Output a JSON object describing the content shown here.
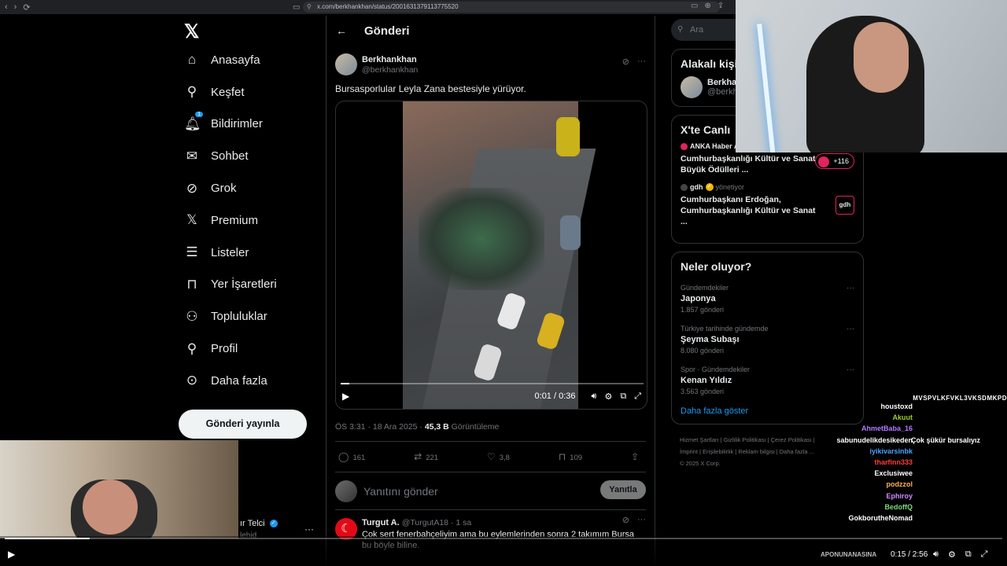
{
  "browser": {
    "url": "x.com/berkhankhan/status/2001631379113775520"
  },
  "sidebar": {
    "items": [
      {
        "label": "Anasayfa"
      },
      {
        "label": "Keşfet"
      },
      {
        "label": "Bildirimler",
        "badge": "1"
      },
      {
        "label": "Sohbet"
      },
      {
        "label": "Grok"
      },
      {
        "label": "Premium"
      },
      {
        "label": "Listeler"
      },
      {
        "label": "Yer İşaretleri"
      },
      {
        "label": "Topluluklar"
      },
      {
        "label": "Profil"
      },
      {
        "label": "Daha fazla"
      }
    ],
    "post_button": "Gönderi yayınla",
    "user_name": "ır Telci",
    "user_handle": "lehid"
  },
  "main": {
    "header_title": "Gönderi",
    "author_name": "Berkhankhan",
    "author_handle": "@berkhankhan",
    "text": "Bursasporlular Leyla Zana bestesiyle yürüyor.",
    "video": {
      "time": "0:01 / 0:36",
      "progress": 0.028
    },
    "meta_time": "ÖS 3:31 · 18 Ara 2025 · ",
    "meta_views": "45,3 B",
    "meta_views_label": " Görüntüleme",
    "actions": {
      "replies": "161",
      "reposts": "221",
      "likes": "3,8",
      "bookmarks": "109"
    },
    "reply_placeholder": "Yanıtını gönder",
    "reply_button": "Yanıtla",
    "reply": {
      "name": "Turgut A.",
      "handle": "@TurgutA18 · 1 sa",
      "text": "Çok sert fenerbahçeliyim ama bu eylemlerinden sonra 2 takımım Bursa bu böyle biline."
    }
  },
  "right": {
    "search_placeholder": "Ara",
    "related_title": "Alakalı kişi",
    "related_name": "Berkha",
    "related_handle": "@berkh",
    "live_title": "X'te Canlı",
    "live": [
      {
        "source": "ANKA Haber Ajansı",
        "role": "yönetiyor",
        "title": "Cumhurbaşkanlığı Kültür ve Sanat Büyük Ödülleri ...",
        "count": "+116"
      },
      {
        "source": "gdh",
        "role": "yönetiyor",
        "title": "Cumhurbaşkanı Erdoğan, Cumhurbaşkanlığı Kültür ve Sanat ...",
        "logo": "gdh"
      }
    ],
    "trends_title": "Neler oluyor?",
    "trends": [
      {
        "context": "Gündemdekiler",
        "name": "Japonya",
        "count": "1.857 gönderi"
      },
      {
        "context": "Türkiye tarihinde gündemde",
        "name": "Şeyma Subaşı",
        "count": "8.080 gönderi"
      },
      {
        "context": "Spor · Gündemdekiler",
        "name": "Kenan Yıldız",
        "count": "3.563 gönderi"
      }
    ],
    "show_more": "Daha fazla göster",
    "footer": [
      "Hizmet Şartları",
      "Gizlilik Politikası",
      "Çerez Politikası",
      "İmprint",
      "Erişilebilirlik",
      "Reklam bilgisi",
      "Daha fazla ...",
      "© 2025 X Corp."
    ]
  },
  "chat": {
    "partial": "MVSPVLKFVKL3VKSDMKPD",
    "lines": [
      {
        "name": "houstoxd",
        "color": "#ffffff",
        "msg": ""
      },
      {
        "name": "Akuut",
        "color": "#9acd32",
        "msg": ""
      },
      {
        "name": "AhmetBaba_16",
        "color": "#b27aff",
        "msg": ""
      },
      {
        "name": "sabunudelikdesikeden",
        "color": "#ffffff",
        "msg": "Çok şükür bursalıyız"
      },
      {
        "name": "iyikivarsinbk",
        "color": "#4aa3ff",
        "msg": ""
      },
      {
        "name": "tharfinn333",
        "color": "#ff3b3b",
        "msg": ""
      },
      {
        "name": "Exclusiwee",
        "color": "#ffffff",
        "msg": ""
      },
      {
        "name": "podzzol",
        "color": "#ffb347",
        "msg": ""
      },
      {
        "name": "Ephiroy",
        "color": "#d28cff",
        "msg": ""
      },
      {
        "name": "BedoffQ",
        "color": "#7dd87d",
        "msg": ""
      },
      {
        "name": "GokborutheNomad",
        "color": "#ffffff",
        "msg": ""
      }
    ]
  },
  "player": {
    "time": "0:15 / 2:56",
    "progress": 0.085,
    "ticker": "APONUNANASINA"
  }
}
